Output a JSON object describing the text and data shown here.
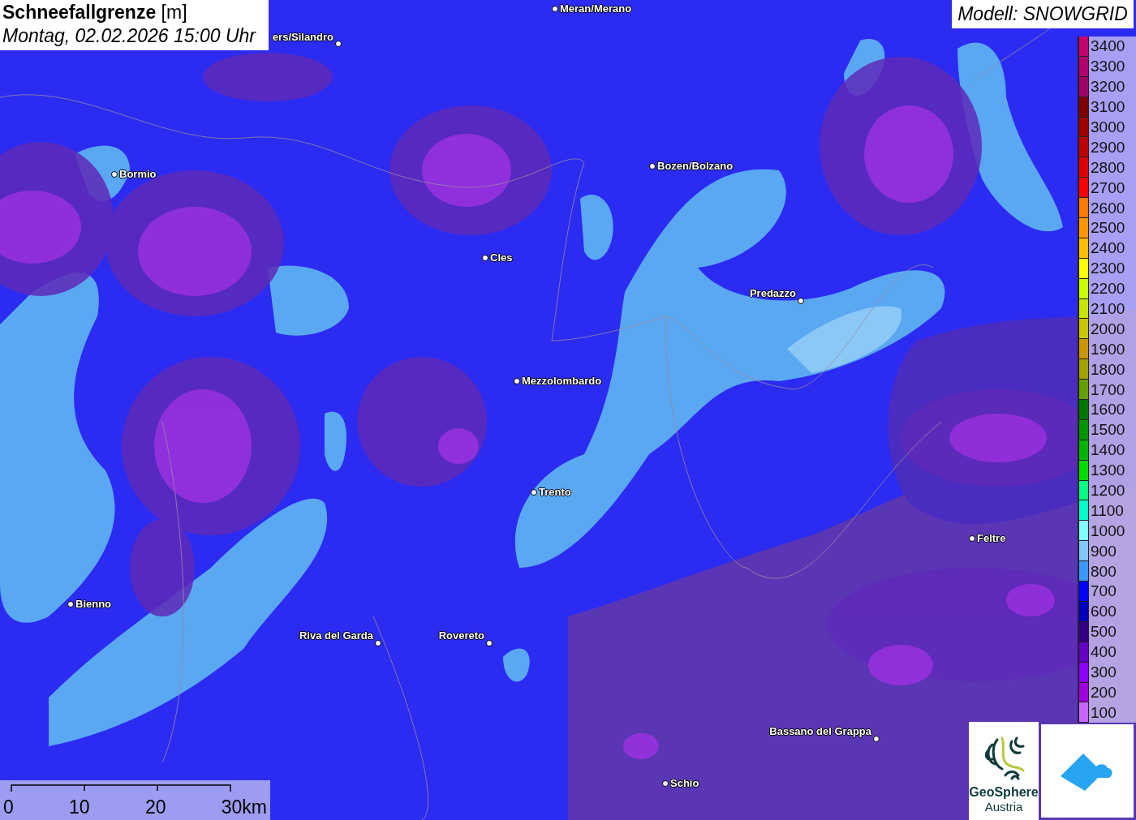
{
  "title": {
    "name": "Schneefallgrenze",
    "unit": "[m]",
    "timestamp": "Montag, 02.02.2026 15:00 Uhr"
  },
  "model": "Modell: SNOWGRID",
  "cities": [
    {
      "name": "Meran/Merano"
    },
    {
      "name": "ers/Silandro"
    },
    {
      "name": "Bormio"
    },
    {
      "name": "Bozen/Bolzano"
    },
    {
      "name": "Cles"
    },
    {
      "name": "Predazzo"
    },
    {
      "name": "Mezzolombardo"
    },
    {
      "name": "Trento"
    },
    {
      "name": "Feltre"
    },
    {
      "name": "Bienno"
    },
    {
      "name": "Riva del Garda"
    },
    {
      "name": "Rovereto"
    },
    {
      "name": "Bassano del Grappa"
    },
    {
      "name": "Schio"
    }
  ],
  "legend": [
    {
      "value": "3400",
      "color": "#c8006e"
    },
    {
      "value": "3300",
      "color": "#b4006e"
    },
    {
      "value": "3200",
      "color": "#a00064"
    },
    {
      "value": "3100",
      "color": "#800000"
    },
    {
      "value": "3000",
      "color": "#a00000"
    },
    {
      "value": "2900",
      "color": "#c00000"
    },
    {
      "value": "2800",
      "color": "#e00000"
    },
    {
      "value": "2700",
      "color": "#ff0000"
    },
    {
      "value": "2600",
      "color": "#ff7800"
    },
    {
      "value": "2500",
      "color": "#ff9600"
    },
    {
      "value": "2400",
      "color": "#ffbe00"
    },
    {
      "value": "2300",
      "color": "#ffff00"
    },
    {
      "value": "2200",
      "color": "#c8ff00"
    },
    {
      "value": "2100",
      "color": "#c8e600"
    },
    {
      "value": "2000",
      "color": "#c8c800"
    },
    {
      "value": "1900",
      "color": "#c89600"
    },
    {
      "value": "1800",
      "color": "#a0a000"
    },
    {
      "value": "1700",
      "color": "#64a000"
    },
    {
      "value": "1600",
      "color": "#007800"
    },
    {
      "value": "1500",
      "color": "#009600"
    },
    {
      "value": "1400",
      "color": "#00b400"
    },
    {
      "value": "1300",
      "color": "#00dc00"
    },
    {
      "value": "1200",
      "color": "#00ff80"
    },
    {
      "value": "1100",
      "color": "#00ffc8"
    },
    {
      "value": "1000",
      "color": "#80ffff"
    },
    {
      "value": "900",
      "color": "#80c8ff"
    },
    {
      "value": "800",
      "color": "#3c96ff"
    },
    {
      "value": "700",
      "color": "#0000ff"
    },
    {
      "value": "600",
      "color": "#0000c0"
    },
    {
      "value": "500",
      "color": "#320080"
    },
    {
      "value": "400",
      "color": "#6400c8"
    },
    {
      "value": "300",
      "color": "#8c00ff"
    },
    {
      "value": "200",
      "color": "#a000e0"
    },
    {
      "value": "100",
      "color": "#c864ff"
    }
  ],
  "scale": {
    "ticks": [
      "0",
      "10",
      "20",
      "30km"
    ]
  },
  "logo": {
    "line_1": "GeoSphere",
    "line_2": "Austria"
  }
}
